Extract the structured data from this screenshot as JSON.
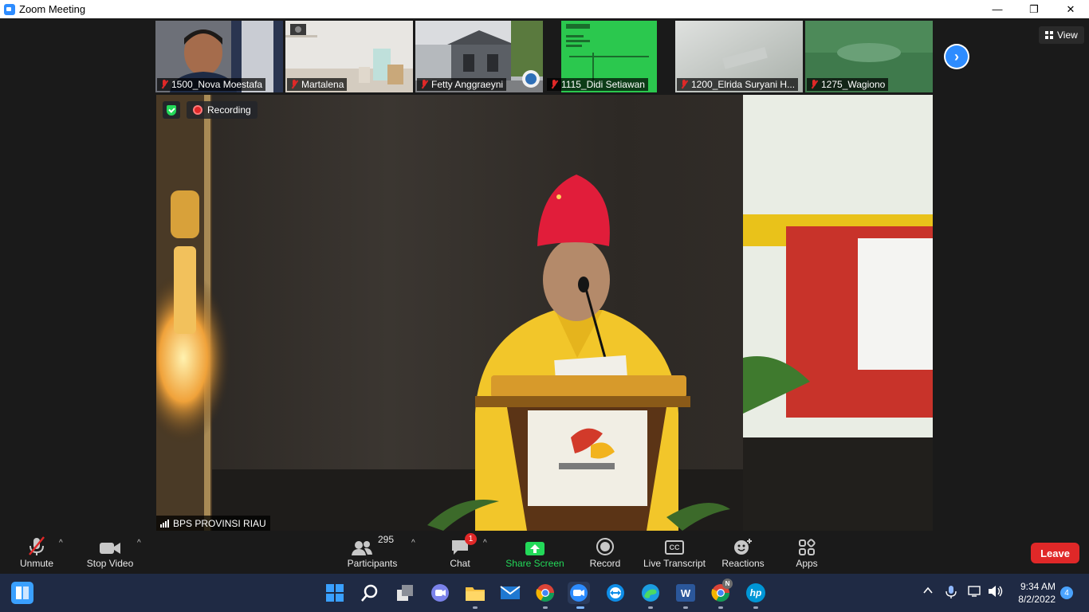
{
  "window": {
    "title": "Zoom Meeting",
    "minimize": "—",
    "restore": "❐",
    "close": "✕"
  },
  "thumbnails": [
    {
      "name": "1500_Nova Moestafa",
      "muted": true
    },
    {
      "name": "Martalena",
      "muted": true
    },
    {
      "name": "Fetty Anggraeyni",
      "muted": true
    },
    {
      "name": "1115_Didi Setiawan",
      "muted": true
    },
    {
      "name": "1200_Elrida Suryani H...",
      "muted": true
    },
    {
      "name": "1275_Wagiono",
      "muted": true
    }
  ],
  "view_button": {
    "label": "View"
  },
  "main_video": {
    "recording_label": "Recording",
    "speaker_name": "BPS PROVINSI RIAU"
  },
  "toolbar": {
    "unmute": "Unmute",
    "stop_video": "Stop Video",
    "participants": "Participants",
    "participants_count": "295",
    "chat": "Chat",
    "chat_badge": "1",
    "share_screen": "Share Screen",
    "record": "Record",
    "live_transcript": "Live Transcript",
    "reactions": "Reactions",
    "apps": "Apps",
    "leave": "Leave",
    "cc_text": "CC"
  },
  "taskbar": {
    "time": "9:34 AM",
    "date": "8/2/2022",
    "notifications": "4",
    "chrome_profile_badge": "N",
    "word_letter": "W",
    "hp_letter": "hp"
  },
  "colors": {
    "accent": "#2d8cff",
    "leave": "#e02828",
    "share": "#23d959",
    "taskbar": "#1f2a44"
  }
}
